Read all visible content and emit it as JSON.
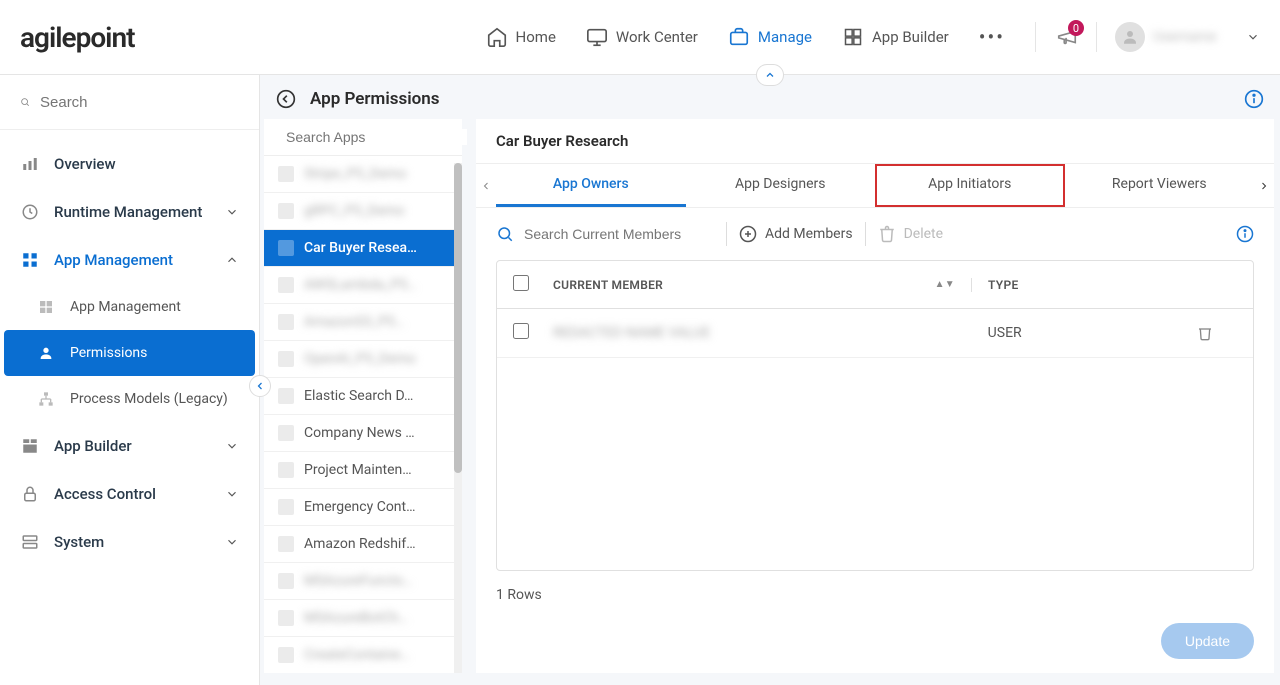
{
  "header": {
    "logo": "agilepoint",
    "nav": {
      "home": "Home",
      "work_center": "Work Center",
      "manage": "Manage",
      "app_builder": "App Builder"
    },
    "badge_count": "0"
  },
  "sidebar": {
    "search_placeholder": "Search",
    "items": {
      "overview": "Overview",
      "runtime": "Runtime Management",
      "app_mgmt": "App Management",
      "children": {
        "app_mgmt_child": "App Management",
        "permissions": "Permissions",
        "process_models": "Process Models (Legacy)"
      },
      "app_builder": "App Builder",
      "access_control": "Access Control",
      "system": "System"
    }
  },
  "page": {
    "title": "App Permissions",
    "apps_search_placeholder": "Search Apps",
    "apps": [
      {
        "label": "Stripe_P5_Demo",
        "blurred": true
      },
      {
        "label": "gRPC_P5_Demo",
        "blurred": true
      },
      {
        "label": "Car Buyer Resea…",
        "selected": true
      },
      {
        "label": "AWSLambda_P5…",
        "blurred": true
      },
      {
        "label": "AmazonS3_P5…",
        "blurred": true
      },
      {
        "label": "OpenAI_P5_Demo",
        "blurred": true
      },
      {
        "label": "Elastic Search D…"
      },
      {
        "label": "Company News …"
      },
      {
        "label": "Project Mainten…"
      },
      {
        "label": "Emergency Cont…"
      },
      {
        "label": "Amazon Redshif…"
      },
      {
        "label": "MSAzureFuncto…",
        "blurred": true
      },
      {
        "label": "MSAzureBotCh…",
        "blurred": true
      },
      {
        "label": "CreateContaine…",
        "blurred": true
      }
    ]
  },
  "perm": {
    "title": "Car Buyer Research",
    "tabs": {
      "owners": "App Owners",
      "designers": "App Designers",
      "initiators": "App Initiators",
      "reporters": "Report Viewers"
    },
    "search_placeholder": "Search Current Members",
    "add_label": "Add Members",
    "delete_label": "Delete",
    "columns": {
      "member": "CURRENT MEMBER",
      "type": "TYPE"
    },
    "rows": [
      {
        "member": "REDACTED NAME VALUE",
        "type": "USER"
      }
    ],
    "footer": "1 Rows",
    "update": "Update"
  }
}
